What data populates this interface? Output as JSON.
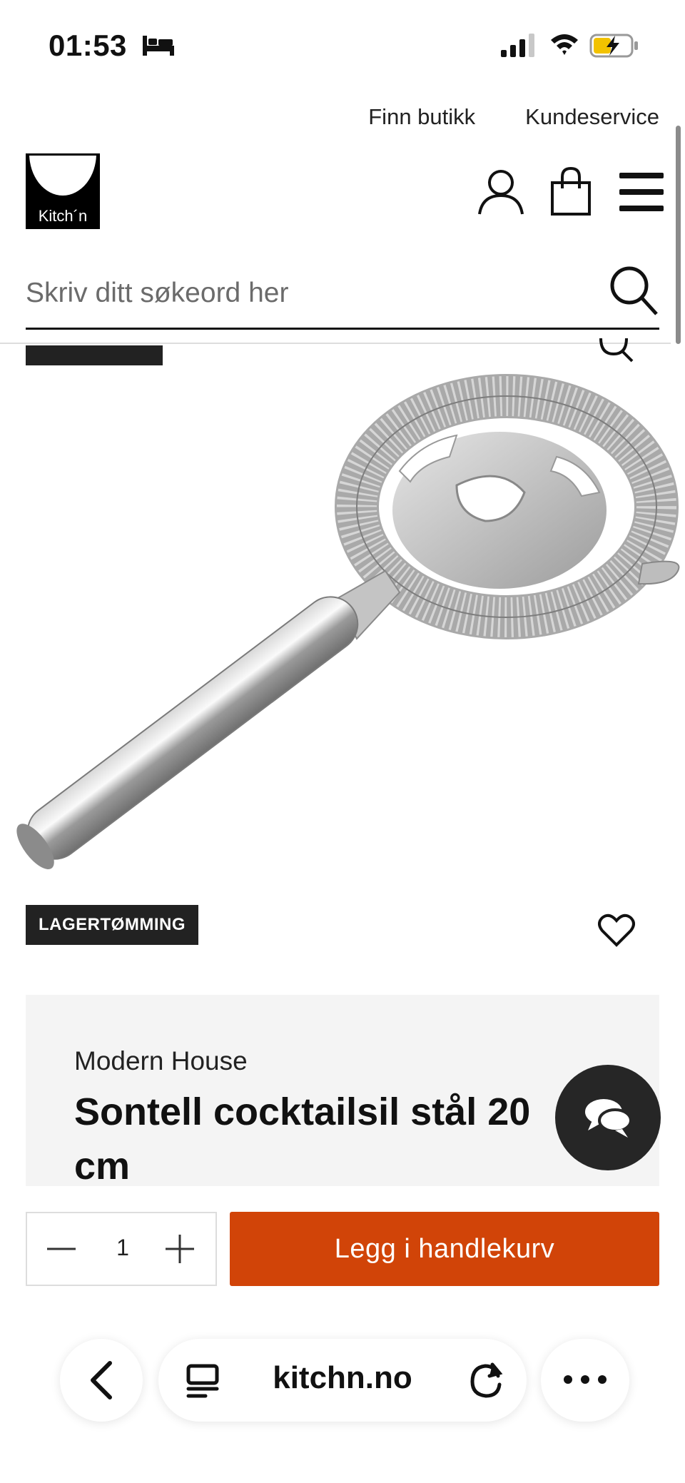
{
  "status_bar": {
    "time": "01:53",
    "icons": [
      "bed-icon",
      "signal-icon",
      "wifi-icon",
      "battery-charging-icon"
    ]
  },
  "top_links": [
    "Finn butikk",
    "Kundeservice"
  ],
  "logo": {
    "text": "Kitch´n"
  },
  "header_icons": [
    "account-icon",
    "cart-icon",
    "menu-icon"
  ],
  "search": {
    "placeholder": "Skriv ditt søkeord her",
    "value": ""
  },
  "product": {
    "badge": "LAGERTØMMING",
    "brand": "Modern House",
    "title": "Sontell cocktailsil stål 20 cm",
    "image_icon": "cocktail-strainer-image"
  },
  "purchase": {
    "quantity": "1",
    "add_to_cart_label": "Legg i handlekurv"
  },
  "browser": {
    "url": "kitchn.no"
  },
  "colors": {
    "accent": "#d14408",
    "dark": "#262626",
    "panel": "#f4f4f4"
  }
}
